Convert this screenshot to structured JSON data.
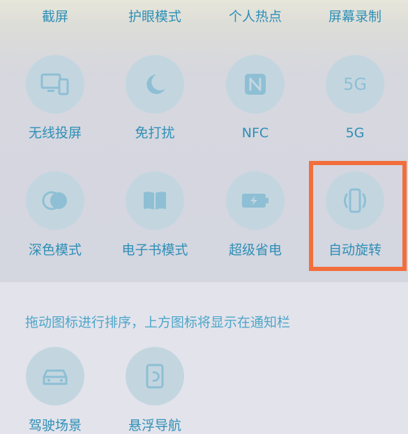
{
  "top_labels": [
    "截屏",
    "护眼模式",
    "个人热点",
    "屏幕录制"
  ],
  "tiles_row1": [
    {
      "label": "无线投屏",
      "icon": "wireless-projection-icon"
    },
    {
      "label": "免打扰",
      "icon": "moon-icon"
    },
    {
      "label": "NFC",
      "icon": "nfc-icon"
    },
    {
      "label": "5G",
      "icon": "5g-icon",
      "icon_text": "5G"
    }
  ],
  "tiles_row2": [
    {
      "label": "深色模式",
      "icon": "dark-mode-icon"
    },
    {
      "label": "电子书模式",
      "icon": "book-icon"
    },
    {
      "label": "超级省电",
      "icon": "battery-icon"
    },
    {
      "label": "自动旋转",
      "icon": "auto-rotate-icon",
      "highlighted": true
    }
  ],
  "hint_text": "拖动图标进行排序，上方图标将显示在通知栏",
  "extra_tiles": [
    {
      "label": "驾驶场景",
      "icon": "car-icon"
    },
    {
      "label": "悬浮导航",
      "icon": "floating-nav-icon"
    }
  ],
  "colors": {
    "label": "#2e8fb6",
    "icon_circle": "#c3d6e0",
    "icon_glyph": "#8ebfd4",
    "highlight_border": "#f26e3c"
  }
}
